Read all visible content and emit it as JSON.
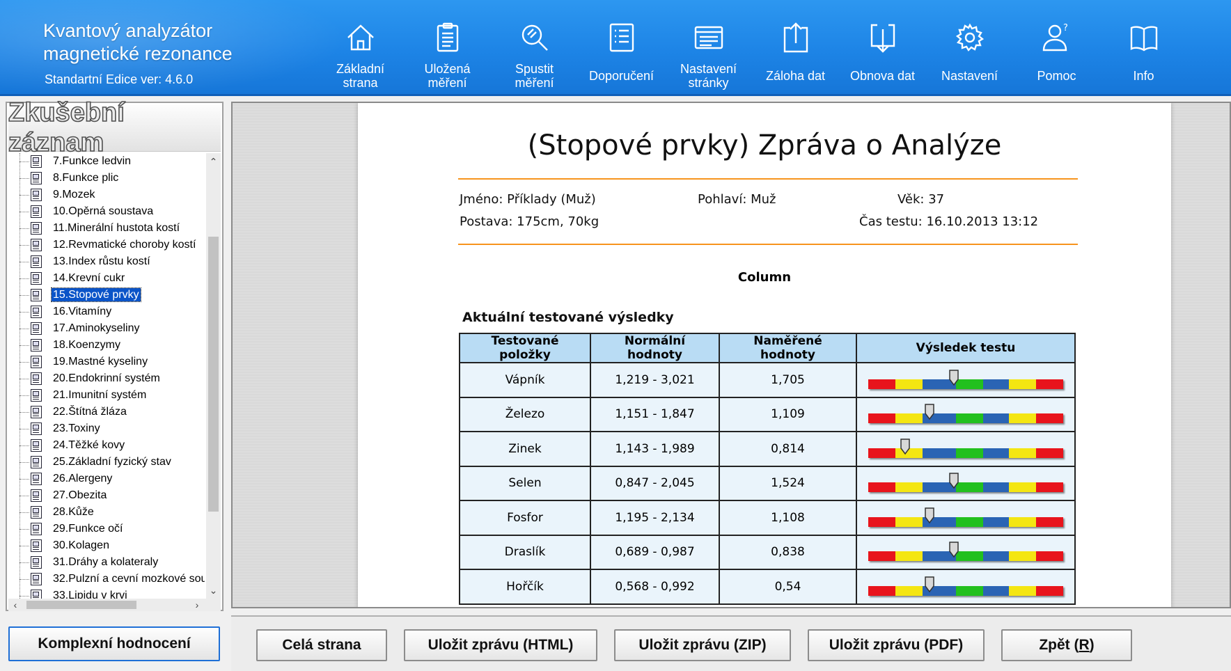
{
  "header": {
    "title_line1": "Kvantový analyzátor",
    "title_line2": "magnetické rezonance",
    "version": "Standartní Edice ver: 4.6.0"
  },
  "toolbar": [
    {
      "icon": "home-icon",
      "label": "Základní\nstrana"
    },
    {
      "icon": "clipboard-icon",
      "label": "Uložená\nměření"
    },
    {
      "icon": "magnifier-icon",
      "label": "Spustit\nměření"
    },
    {
      "icon": "list-icon",
      "label": "Doporučení"
    },
    {
      "icon": "page-settings-icon",
      "label": "Nastavení\nstránky"
    },
    {
      "icon": "upload-icon",
      "label": "Záloha dat"
    },
    {
      "icon": "download-icon",
      "label": "Obnova dat"
    },
    {
      "icon": "gear-icon",
      "label": "Nastavení"
    },
    {
      "icon": "user-help-icon",
      "label": "Pomoc"
    },
    {
      "icon": "book-icon",
      "label": "Info"
    }
  ],
  "sidebar": {
    "title": "Zkušební záznam",
    "selected_index": 8,
    "items": [
      "7.Funkce ledvin",
      "8.Funkce plic",
      "9.Mozek",
      "10.Opěrná soustava",
      "11.Minerální hustota kostí",
      "12.Revmatické choroby kostí",
      "13.Index růstu kostí",
      "14.Krevní cukr",
      "15.Stopové prvky",
      "16.Vitamíny",
      "17.Aminokyseliny",
      "18.Koenzymy",
      "19.Mastné kyseliny",
      "20.Endokrinní systém",
      "21.Imunitní systém",
      "22.Štítná žláza",
      "23.Toxiny",
      "24.Těžké kovy",
      "25.Základní fyzický stav",
      "26.Alergeny",
      "27.Obezita",
      "28.Kůže",
      "29.Funkce očí",
      "30.Kolagen",
      "31.Dráhy a kolateraly",
      "32.Pulzní a cevní mozkové sou",
      "33.Lipidu v krvi"
    ],
    "complex_button": "Komplexní hodnocení"
  },
  "report": {
    "title": "(Stopové prvky) Zpráva o Analýze",
    "name": "Jméno: Příklady (Muž)",
    "gender": "Pohlaví: Muž",
    "age": "Věk: 37",
    "figure": "Postava: 175cm, 70kg",
    "test_time": "Čas testu: 16.10.2013 13:12",
    "column_label": "Column",
    "table_caption": "Aktuální testované výsledky",
    "headers": [
      "Testované položky",
      "Normální hodnoty",
      "Naměřené hodnoty",
      "Výsledek testu"
    ],
    "rows": [
      {
        "item": "Vápník",
        "normal": "1,219 - 3,021",
        "measured": "1,705",
        "level": 0.44
      },
      {
        "item": "Železo",
        "normal": "1,151 - 1,847",
        "measured": "1,109",
        "level": 0.315
      },
      {
        "item": "Zinek",
        "normal": "1,143 - 1,989",
        "measured": "0,814",
        "level": 0.19
      },
      {
        "item": "Selen",
        "normal": "0,847 - 2,045",
        "measured": "1,524",
        "level": 0.44
      },
      {
        "item": "Fosfor",
        "normal": "1,195 - 2,134",
        "measured": "1,108",
        "level": 0.315
      },
      {
        "item": "Draslík",
        "normal": "0,689 - 0,987",
        "measured": "0,838",
        "level": 0.44
      },
      {
        "item": "Hořčík",
        "normal": "0,568 - 0,992",
        "measured": "0,54",
        "level": 0.315
      }
    ],
    "gauge_colors": [
      "#e8141c",
      "#f4e612",
      "#2a64b4",
      "#22c01e",
      "#2a64b4",
      "#f4e612",
      "#e8141c"
    ]
  },
  "bottom_buttons": {
    "full_page": "Celá strana",
    "save_html": "Uložit zprávu (HTML)",
    "save_zip": "Uložit zprávu (ZIP)",
    "save_pdf": "Uložit zprávu (PDF)",
    "back": "Zpět (R)"
  }
}
